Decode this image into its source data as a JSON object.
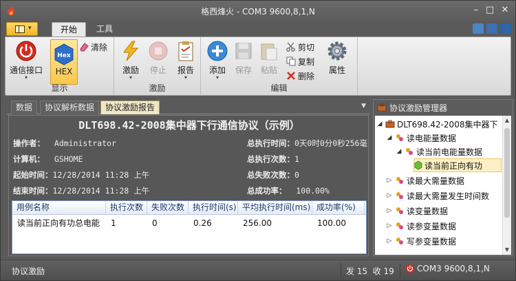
{
  "window": {
    "title": "格西烽火 - COM3  9600,8,1,N",
    "controls": [
      "minimize-icon",
      "maximize-icon",
      "close-icon"
    ]
  },
  "ribbon_tabs": [
    "开始",
    "工具"
  ],
  "ribbon_tab_active": "开始",
  "ribbon": {
    "display_group": {
      "label": "显示",
      "comm_port_label": "通信接口",
      "hex_label": "HEX",
      "hex_icon_text": "Hex",
      "clear_label": "清除"
    },
    "stimulus_group": {
      "label": "激励",
      "stimulus_label": "激励",
      "stop_label": "停止",
      "report_label": "报告"
    },
    "edit_group": {
      "label": "编辑",
      "add_label": "添加",
      "save_label": "保存",
      "paste_label": "粘贴",
      "cut_label": "剪切",
      "copy_label": "复制",
      "delete_label": "删除",
      "properties_label": "属性"
    }
  },
  "doc_tabs": [
    "数据",
    "协议解析数据",
    "协议激励报告"
  ],
  "doc_tab_active": "协议激励报告",
  "report": {
    "title": "DLT698.42-2008集中器下行通信协议（示例）",
    "operator_label": "操作者：",
    "operator": "Administrator",
    "computer_label": "计算机：",
    "computer": "GSHOME",
    "start_label": "起始时间：",
    "start": "12/28/2014 11:28 上午",
    "end_label": "结束时间：",
    "end": "12/28/2014 11:28 上午",
    "total_time_label": "总执行时间：",
    "total_time": "0天0时0分0秒256毫",
    "total_count_label": "总执行次数：",
    "total_count": "1",
    "fail_count_label": "总失败次数：",
    "fail_count": "0",
    "success_rate_label": "总成功率：",
    "success_rate": "100.00%"
  },
  "table": {
    "columns": [
      "用例名称",
      "执行次数",
      "失败次数",
      "执行时间(s)",
      "平均执行时间(ms)",
      "成功率(%)"
    ],
    "rows": [
      [
        "读当前正向有功总电能",
        "1",
        "0",
        "0.26",
        "256.00",
        "100.00"
      ]
    ]
  },
  "manager": {
    "title": "协议激励管理器",
    "tree": [
      {
        "label": "DLT698.42-2008集中器下",
        "level": 0,
        "expanded": true
      },
      {
        "label": "读电能量数据",
        "level": 1,
        "expanded": true
      },
      {
        "label": "读当前电能量数据",
        "level": 2,
        "expanded": true
      },
      {
        "label": "读当前正向有功",
        "level": 3,
        "selected": true
      },
      {
        "label": "读最大需量数据",
        "level": 1,
        "expanded": false
      },
      {
        "label": "读最大需量发生时间数",
        "level": 1,
        "expanded": false
      },
      {
        "label": "读变量数据",
        "level": 1,
        "expanded": false
      },
      {
        "label": "读参变量数据",
        "level": 1,
        "expanded": false
      },
      {
        "label": "写参变量数据",
        "level": 1,
        "expanded": false
      }
    ]
  },
  "status": {
    "mode": "协议激励",
    "sent": "发 15",
    "received": "收 19",
    "port": "COM3  9600,8,1,N"
  },
  "colors": {
    "accent_orange": "#f0b628",
    "power_red": "#d42a1f",
    "selection": "#fdf0c4"
  }
}
